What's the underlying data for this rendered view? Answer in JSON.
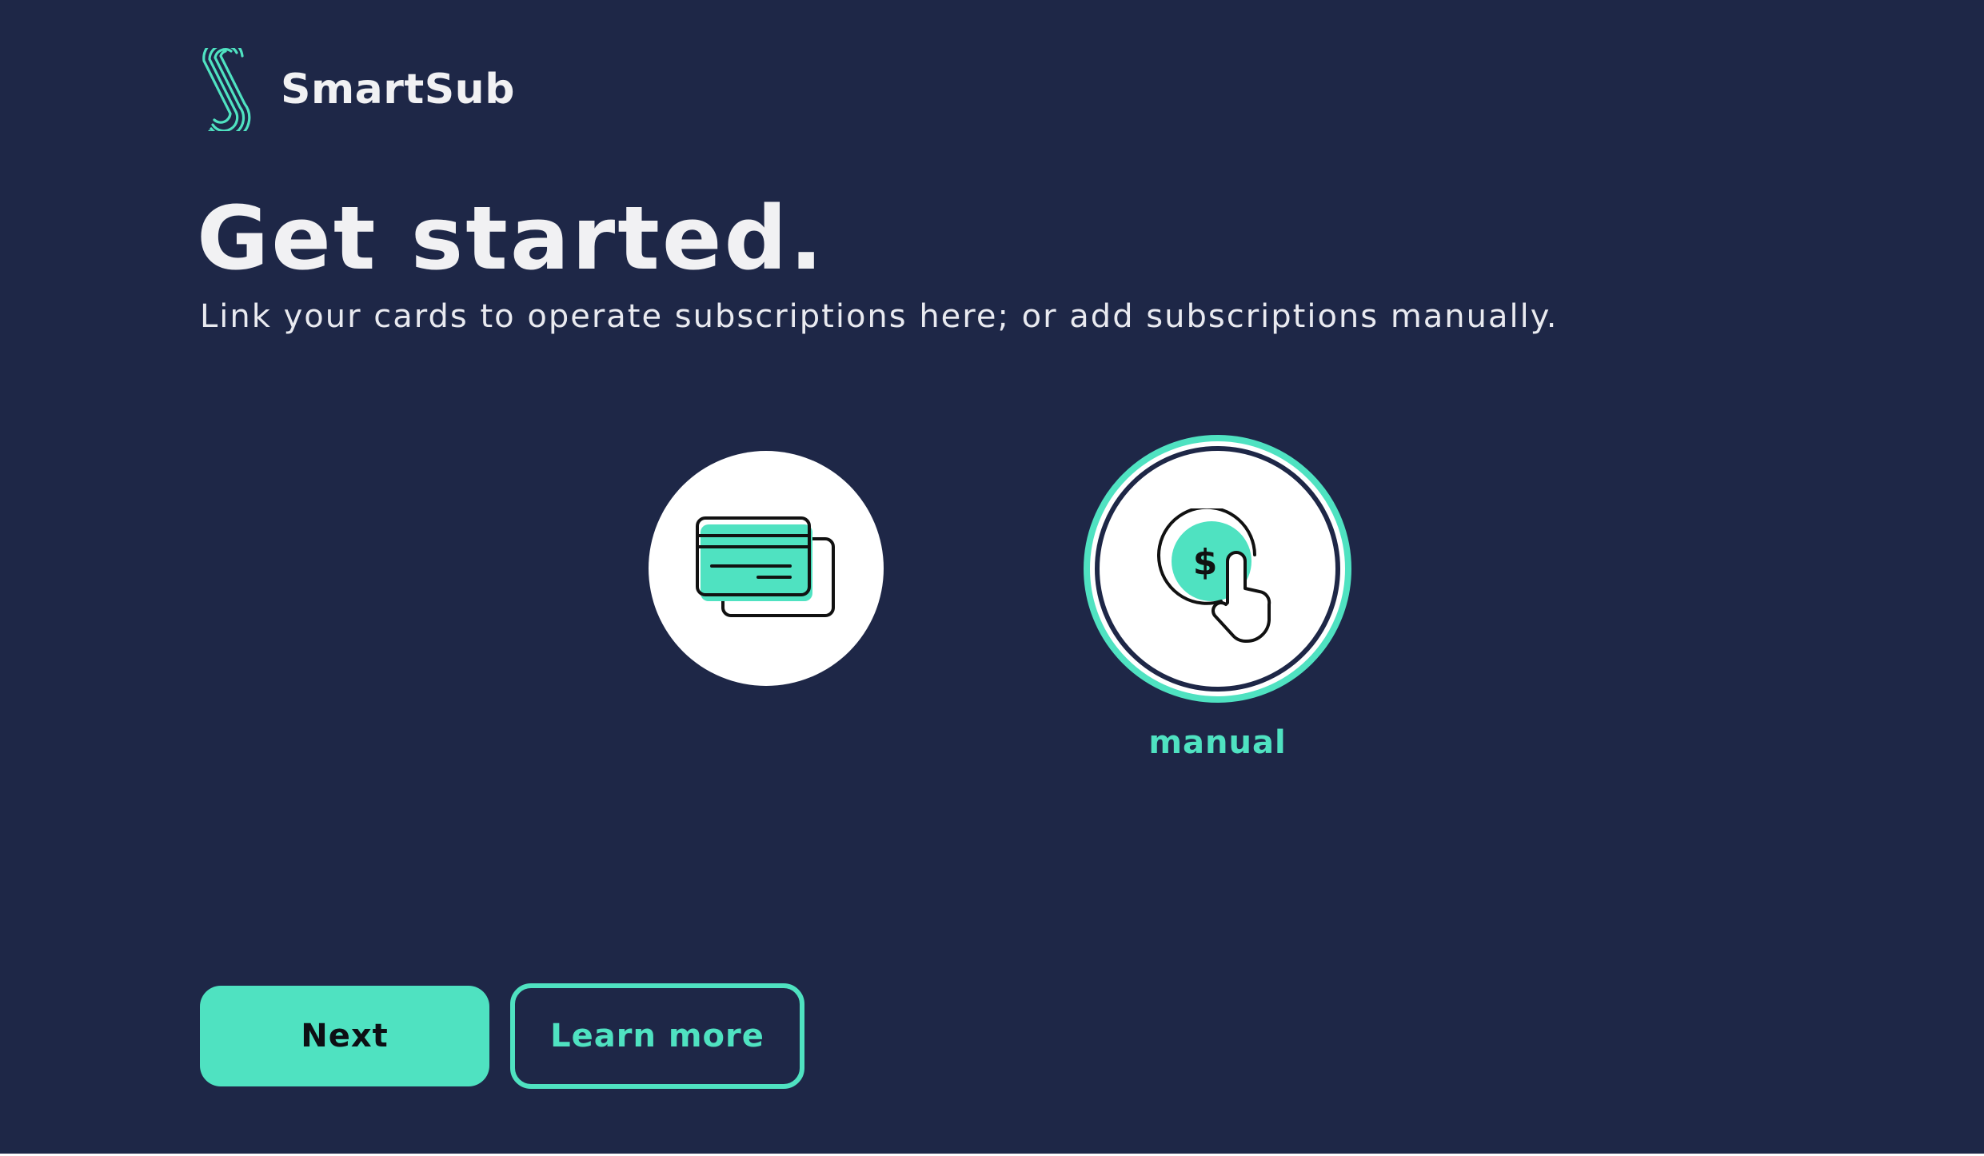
{
  "app": {
    "name": "SmartSub",
    "logo_icon": "smartsub-logo"
  },
  "colors": {
    "background": "#1e2747",
    "accent": "#4fe2c1",
    "text": "#f1f1f3",
    "bottom_strip": "#ffffff"
  },
  "header": {
    "title": "Get started.",
    "subtitle": "Link your cards to operate subscriptions here; or add subscriptions manually."
  },
  "options": [
    {
      "id": "card",
      "icon": "credit-cards-icon",
      "label": "",
      "selected": false
    },
    {
      "id": "manual",
      "icon": "manual-payment-hand-icon",
      "label": "manual",
      "selected": true
    }
  ],
  "actions": {
    "next_label": "Next",
    "learn_more_label": "Learn more"
  }
}
